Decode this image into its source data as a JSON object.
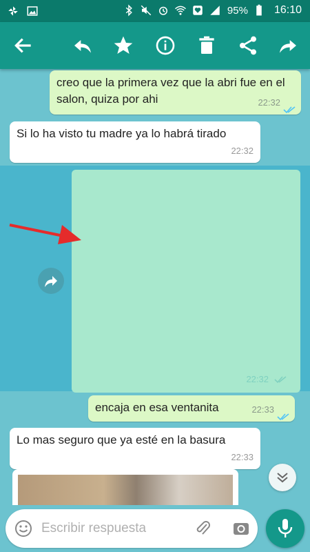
{
  "status_bar": {
    "battery": "95%",
    "time": "16:10",
    "icons": [
      "pinwheel-icon",
      "image-icon",
      "bluetooth-icon",
      "mute-icon",
      "alarm-icon",
      "wifi-icon",
      "heart-icon",
      "signal-icon"
    ]
  },
  "toolbar": {
    "actions": [
      "back-icon",
      "reply-icon",
      "star-icon",
      "info-icon",
      "delete-icon",
      "share-icon",
      "forward-icon"
    ]
  },
  "messages": [
    {
      "type": "outgoing",
      "text": "creo que la primera vez que la abri fue en el salon, quiza por ahi",
      "time": "22:32",
      "status": "read"
    },
    {
      "type": "incoming",
      "text": "Si lo ha visto tu madre ya lo habrá tirado",
      "time": "22:32"
    },
    {
      "type": "outgoing-media",
      "time": "22:32",
      "status": "read",
      "selected": true
    },
    {
      "type": "outgoing",
      "text": "encaja en esa ventanita",
      "time": "22:33",
      "status": "read"
    },
    {
      "type": "incoming",
      "text": "Lo mas seguro que ya esté en la basura",
      "time": "22:33"
    },
    {
      "type": "incoming-photo"
    }
  ],
  "input": {
    "placeholder": "Escribir respuesta"
  },
  "colors": {
    "primary": "#14988a",
    "primary_dark": "#0b7a6b",
    "outgoing_bubble": "#dcf8c6",
    "incoming_bubble": "#ffffff",
    "read_ticks": "#4fc3f7",
    "annotation_arrow": "#e52b2b"
  }
}
